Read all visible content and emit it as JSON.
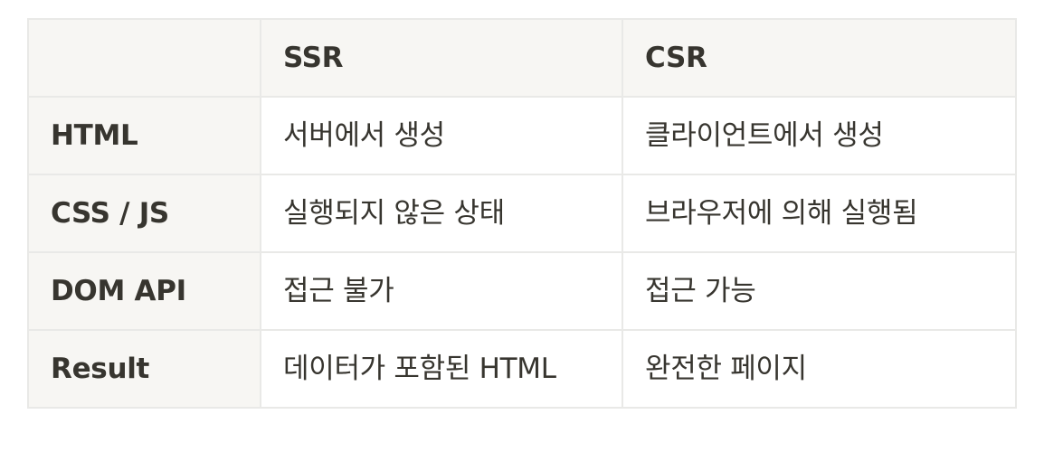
{
  "table": {
    "columns": [
      "",
      "SSR",
      "CSR"
    ],
    "rows": [
      {
        "label": "HTML",
        "ssr": "서버에서 생성",
        "csr": "클라이언트에서 생성"
      },
      {
        "label": "CSS / JS",
        "ssr": "실행되지 않은 상태",
        "csr": "브라우저에 의해 실행됨"
      },
      {
        "label": "DOM API",
        "ssr": "접근 불가",
        "csr": "접근 가능"
      },
      {
        "label": "Result",
        "ssr": "데이터가 포함된 HTML",
        "csr": "완전한 페이지"
      }
    ]
  },
  "colors": {
    "header_bg": "#f7f6f3",
    "border": "#e9e9e7",
    "text": "#37352f"
  }
}
